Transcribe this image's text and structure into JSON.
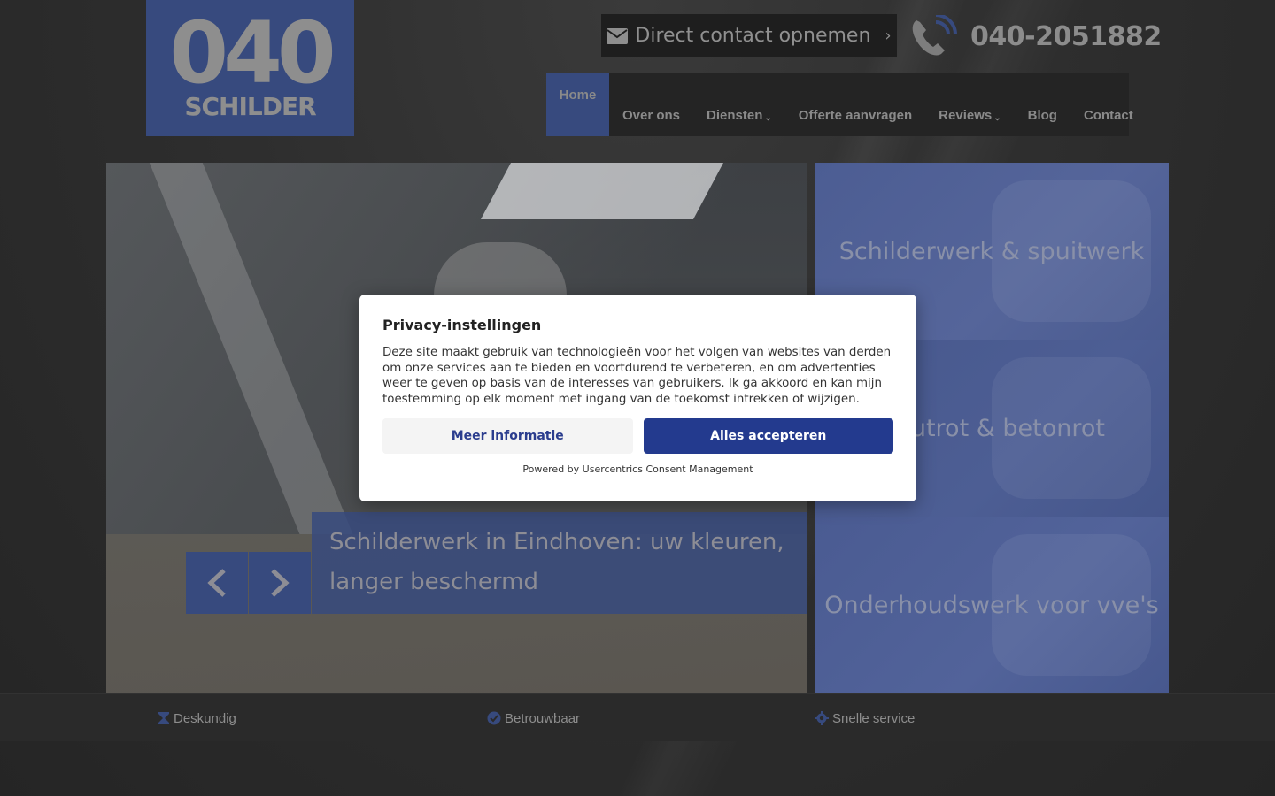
{
  "logo": {
    "number": "040",
    "word": "SCHILDER"
  },
  "header": {
    "contact_button": "Direct contact opnemen",
    "contact_chevron": "›",
    "phone": "040-2051882"
  },
  "nav": {
    "items": [
      {
        "label": "Home",
        "active": true
      },
      {
        "label": "Over ons"
      },
      {
        "label": "Diensten",
        "caret": "⌄"
      },
      {
        "label": "Offerte aanvragen"
      },
      {
        "label": "Reviews",
        "caret": "⌄"
      },
      {
        "label": "Blog"
      },
      {
        "label": "Contact"
      }
    ]
  },
  "hero": {
    "caption": "Schilderwerk in Eindhoven: uw kleuren, langer beschermd"
  },
  "tiles": [
    {
      "label": "Schilderwerk & spuitwerk"
    },
    {
      "label": "Houtrot & betonrot"
    },
    {
      "label": "Onderhoudswerk voor vve's"
    }
  ],
  "usps": [
    {
      "label": "Deskundig",
      "icon": "hourglass-icon"
    },
    {
      "label": "Betrouwbaar",
      "icon": "check-badge-icon"
    },
    {
      "label": "Snelle service",
      "icon": "gear-icon"
    }
  ],
  "consent": {
    "title": "Privacy-instellingen",
    "body": "Deze site maakt gebruik van technologieën voor het volgen van websites van derden om onze services aan te bieden en voortdurend te verbeteren, en om advertenties weer te geven op basis van de interesses van gebruikers. Ik ga akkoord en kan mijn toestemming op elk moment met ingang van de toekomst intrekken of wijzigen.",
    "more_button": "Meer informatie",
    "accept_button": "Alles accepteren",
    "powered_by": "Powered by Usercentrics Consent Management"
  },
  "colors": {
    "brand_blue": "#374a7e",
    "accept_blue": "#233a8e",
    "background": "#2b2b2b"
  }
}
